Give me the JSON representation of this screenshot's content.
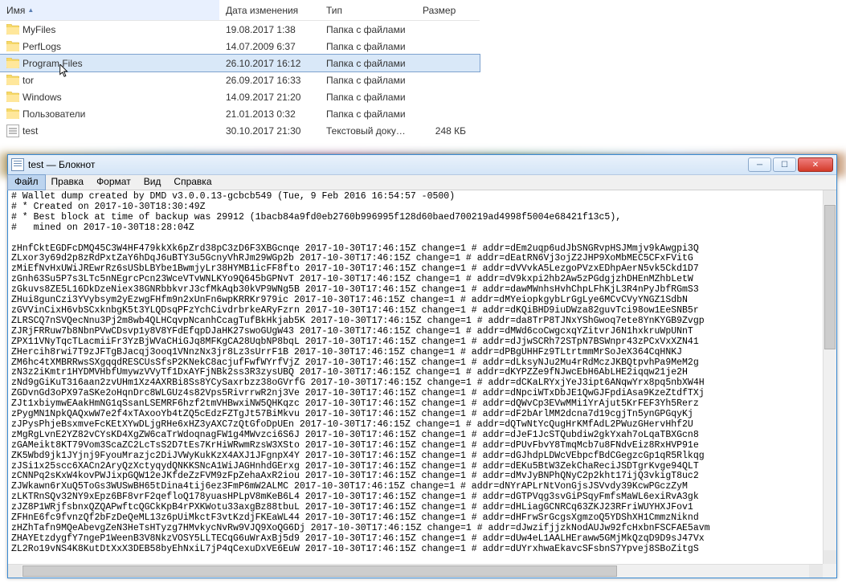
{
  "explorer": {
    "columns": {
      "name": "Имя",
      "date": "Дата изменения",
      "type": "Тип",
      "size": "Размер"
    },
    "rows": [
      {
        "icon": "folder",
        "name": "MyFiles",
        "date": "19.08.2017 1:38",
        "type": "Папка с файлами",
        "size": "",
        "selected": false
      },
      {
        "icon": "folder",
        "name": "PerfLogs",
        "date": "14.07.2009 6:37",
        "type": "Папка с файлами",
        "size": "",
        "selected": false
      },
      {
        "icon": "folder",
        "name": "Program Files",
        "date": "26.10.2017 16:12",
        "type": "Папка с файлами",
        "size": "",
        "selected": true
      },
      {
        "icon": "folder",
        "name": "tor",
        "date": "26.09.2017 16:33",
        "type": "Папка с файлами",
        "size": "",
        "selected": false
      },
      {
        "icon": "folder",
        "name": "Windows",
        "date": "14.09.2017 21:20",
        "type": "Папка с файлами",
        "size": "",
        "selected": false
      },
      {
        "icon": "folder",
        "name": "Пользователи",
        "date": "21.01.2013 0:32",
        "type": "Папка с файлами",
        "size": "",
        "selected": false
      },
      {
        "icon": "file",
        "name": "test",
        "date": "30.10.2017 21:30",
        "type": "Текстовый докум...",
        "size": "248 КБ",
        "selected": false
      }
    ]
  },
  "notepad": {
    "title": "test — Блокнот",
    "menu": {
      "file": "Файл",
      "edit": "Правка",
      "format": "Формат",
      "view": "Вид",
      "help": "Справка",
      "hovered": "file"
    },
    "body_lines": [
      "# Wallet dump created by DMD v3.0.0.13-gcbcb549 (Tue, 9 Feb 2016 16:54:57 -0500)",
      "# * Created on 2017-10-30T18:30:49Z",
      "# * Best block at time of backup was 29912 (1bacb84a9fd0eb2760b996995f128d60baed700219ad4998f5004e68421f13c5),",
      "#   mined on 2017-10-30T18:28:04Z",
      "",
      "zHnfCktEGDFcDMQ45C3W4HF479kkXk6pZrd38pC3zD6F3XBGcnqe 2017-10-30T17:46:15Z change=1 # addr=dEm2uqp6udJbSNGRvpHSJMmjv9kAwgpi3Q",
      "ZLxor3y69d2p8zRdPxtZaY6hDqJ6uBTY3u5GcnyVhRJm29WGp2b 2017-10-30T17:46:15Z change=1 # addr=dEatRN6Vj3ojZ2JHP9XoMbMEC5CFxFVitG",
      "zMiEfNvHxUWiJREwrRz6sUSbLBYbe1BwmjyLr38HYMB1icFF8fto 2017-10-30T17:46:15Z change=1 # addr=dVVvkA5LezgoPVzxEDhpAerN5vk5Ckd1D7",
      "zGnh63Su5P7s3LTc5nNEgrcPcn23WceVTvWNLKYo9Q645bGPNvT 2017-10-30T17:46:15Z change=1 # addr=dV9kxpi2hb2Aw5zPGdgjzhDHEnMZhbLetW",
      "zGkuvs8ZE5L16DkDzeNiex38GNRbbkvrJ3cfMkAqb30kVP9WNg5B 2017-10-30T17:46:15Z change=1 # addr=dawMWnhsHvhChpLFhKjL3R4nPyJbfRGmS3",
      "ZHui8gunCzi3YVybsym2yEzwgFHfm9n2xUnFn6wpKRRKr979ic 2017-10-30T17:46:15Z change=1 # addr=dMYeiopkgybLrGgLye6MCvCVyYNGZ1SdbN",
      "zGVVinCixH6vbSCxknbgK5t3YLQDsqPFzYchCivdrbrkeARyFzrn 2017-10-30T17:46:15Z change=1 # addr=dKQiBHD9iuDWza82guvTci98ow1EeSNB5r",
      "ZLRSCQ7nSVQecNnu3Pj2m8wb4QLHCqvpNcanhCcagTufBkHkjab5K 2017-10-30T17:46:15Z change=1 # addr=da8TrP8TJNxYShGwoq7ete8YnKYGB9Zvgp",
      "ZJRjFRRuw7b8NbnPVwCDsvp1y8V8YFdEfqpDJaHK27swoGUgW43 2017-10-30T17:46:15Z change=1 # addr=dMWd6coCwgcxqYZitvrJ6N1hxkruWpUNnT",
      "ZPX11VNyTqcTLacmiiFr3YzBjWVaCHiGJq8MFKgCA28UqbNP8bqL 2017-10-30T17:46:15Z change=1 # addr=dJjwSCRh72STpN7BSWnpr43zPCxVxXZN41",
      "ZHercih8rwi7T9zJFTgBJacqj3ooq1VNnzNx3jr8Lz3sUrrF1B 2017-10-30T17:46:15Z change=1 # addr=dPBgUHHFz9TLtrtmmMrSoJeX364CqHNKJ",
      "ZM6hc4tXMBRRwsSXgqqdRESCUsSfsP2KNekC8acjufFwfWYrfVjZ 2017-10-30T17:46:15Z change=1 # addr=dLksyNJu2Mu4rRdMczJKBQtpvhPa9MeM2g",
      "zN3z2iKmtr1HYDMVHbfUmywzVVyTf1DxAYFjNBk2ss3R3zysUBQ 2017-10-30T17:46:15Z change=1 # addr=dKYPZZe9fNJwcEbH6AbLHE2iqqw21je2H",
      "zNd9gGiKuT316aan2zvUHm1Xz4AXRBi8Ss8YCySaxrbzz38oGVrfG 2017-10-30T17:46:15Z change=1 # addr=dCKaLRYxjYeJ3ipt6ANqwYrx8pq5nbXW4H",
      "ZGDvnGd3oPX97aSKe2oHqnDrc8WLGUz4s82Vps5RivrrwR2nj3Ve 2017-10-30T17:46:15Z change=1 # addr=dNpciWTxDbJE1QwGJFpdiAsa9KzeZtdfTXj",
      "ZJt1xbiymwEAakHmNG1qSsanLSEMRF6hzf2tmVHBwxiNW5QHKqzc 2017-10-30T17:46:15Z change=1 # addr=dQWvCp3EVwMMi1YrAjut5KrFEF3Yh5Rerz",
      "zPygMN1NpkQAQxwW7e2f4xTAxooYb4tZQ5cEdzFZTgJt57BiMkvu 2017-10-30T17:46:15Z change=1 # addr=dF2bArlMM2dcna7d19cgjTn5ynGPGqyKj",
      "zJPysPhjeBsxmveFcKEtXYwDLjgRHe6xHZ3yAXC7zQtGfoDpUEn 2017-10-30T17:46:15Z change=1 # addr=dQTwNtYcQugHrKMfAdL2PWuzGHervHhf2U",
      "zMgRgLvnE2YZ82vCYsKD4XgZW6caTrWdoqnagFW1g4MWvzci6S6J 2017-10-30T17:46:15Z change=1 # addr=dJeF1JcSTQubdiw2gkYxah7oLqaTBXGcn8",
      "zGAMeikt8KT79Vom3ScaZC2LcTsS2D7tEs7KrHiWRwmRzsW3XSto 2017-10-30T17:46:15Z change=1 # addr=dPUvFbvY8TmqMcb7u8FNdvEiz8RxHVP91e",
      "ZK5Wbd9jk1JYjnj9FyouMrazjc2DiJVWyKukKzX4AXJ1JFgnpX4Y 2017-10-30T17:46:15Z change=1 # addr=dGJhdpLDWcVEbpcfBdCGegzcGp1qR5Rlkqg",
      "zJSi1x25scc6XACn2AryQzXctyqydQNKKSNcA1WiJAGHnhdGErxg 2017-10-30T17:46:15Z change=1 # addr=dEKu5BtW3ZekChaReciJSDTgrKvge94QLT",
      "zCNNPq2sKxW4kovPWJixpGQW12eJKfdeZzFVM9zFpZehaAxR2iou 2017-10-30T17:46:15Z change=1 # addr=dMvJyBNPhQNyC2p2kht17ijQ3vkigT8uc2",
      "ZJWkawn6rXuQ5ToGs3WUSwBH65tDina4tij6ez3FmP6mW2ALMC 2017-10-30T17:46:15Z change=1 # addr=dNYrAPLrNtVonGjsJSVvdy39KcwPGczZyM",
      "zLKTRnSQv32NY9xEpz6BF8vrF2qefloQ178yuasHPLpV8mKeB6L4 2017-10-30T17:46:15Z change=1 # addr=dGTPVqg3svGiPSqyFmfsMaWL6exiRvA3gk",
      "zJZ8P1WRjfsbnxQZQAPwftcQGCkKpB4rPXKWotu33axgBz88tbuL 2017-10-30T17:46:15Z change=1 # addr=dHLiagGCNRCq63ZKJ23RFriWUYHXJFov1",
      "ZFHnE6fc9fvnzQf2bFzDeQeML13z6pUiMkctF3vtKzdjFKEaWL44 2017-10-30T17:46:15Z change=1 # addr=dHFrwSrGcgsXgmzoQ5YDShXH1CmmzNiknd",
      "zHZhTafn9MQeAbevgZeN3HeTsHTyzg7HMvkycNvRw9VJQ9XoQG6Dj 2017-10-30T17:46:15Z change=1 # addr=dJwzifjjzkNodAUJw92fcHxbnFSCFAE5avm",
      "ZHAYEtzdygfY7ngeP1WeenB3V8NkzVOSY5LLTECqG6uWrAxBj5d9 2017-10-30T17:46:15Z change=1 # addr=dUw4eL1AALHEraww5GMjMkQzqD9D9sJ47Vx",
      "ZL2Ro19vNS4K8KutDtXxX3DEB58byEhNxiL7jP4qCexuDxVE6EuW 2017-10-30T17:46:15Z change=1 # addr=dUYrxhwaEkavcSFsbnS7Ypvej8SBoZitgS"
    ]
  }
}
